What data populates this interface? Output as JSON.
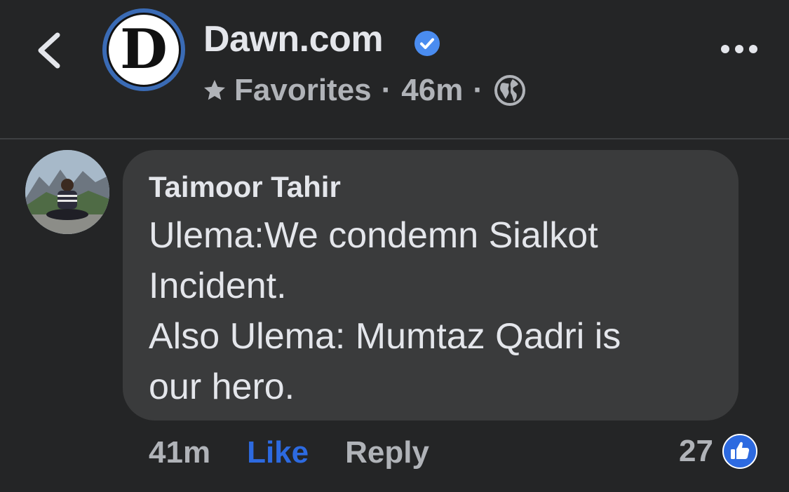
{
  "header": {
    "page_name": "Dawn.com",
    "logo_letter": "D",
    "audience": "Favorites",
    "time_ago": "46m",
    "separator": "·",
    "icons": {
      "back": "chevron-left-icon",
      "verified": "verified-badge-icon",
      "favorites": "star-icon",
      "privacy": "globe-icon",
      "more": "more-dots-icon"
    }
  },
  "comment": {
    "author": "Taimoor Tahir",
    "text": "Ulema:We condemn Sialkot\nIncident.\nAlso Ulema: Mumtaz Qadri is\nour hero.",
    "time_ago": "41m",
    "like_label": "Like",
    "reply_label": "Reply",
    "reaction_count": "27",
    "reaction_icon": "like-reaction-icon"
  },
  "colors": {
    "background": "#242526",
    "bubble": "#3a3b3c",
    "primary_text": "#e4e6eb",
    "secondary_text": "#b0b3b8",
    "accent_blue": "#2d6ae0"
  }
}
